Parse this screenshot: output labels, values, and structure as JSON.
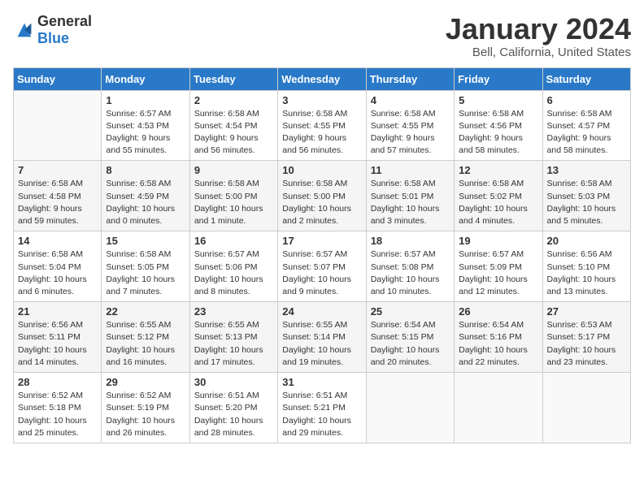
{
  "logo": {
    "text_general": "General",
    "text_blue": "Blue"
  },
  "title": "January 2024",
  "subtitle": "Bell, California, United States",
  "days_of_week": [
    "Sunday",
    "Monday",
    "Tuesday",
    "Wednesday",
    "Thursday",
    "Friday",
    "Saturday"
  ],
  "weeks": [
    [
      {
        "day": "",
        "info": ""
      },
      {
        "day": "1",
        "info": "Sunrise: 6:57 AM\nSunset: 4:53 PM\nDaylight: 9 hours\nand 55 minutes."
      },
      {
        "day": "2",
        "info": "Sunrise: 6:58 AM\nSunset: 4:54 PM\nDaylight: 9 hours\nand 56 minutes."
      },
      {
        "day": "3",
        "info": "Sunrise: 6:58 AM\nSunset: 4:55 PM\nDaylight: 9 hours\nand 56 minutes."
      },
      {
        "day": "4",
        "info": "Sunrise: 6:58 AM\nSunset: 4:55 PM\nDaylight: 9 hours\nand 57 minutes."
      },
      {
        "day": "5",
        "info": "Sunrise: 6:58 AM\nSunset: 4:56 PM\nDaylight: 9 hours\nand 58 minutes."
      },
      {
        "day": "6",
        "info": "Sunrise: 6:58 AM\nSunset: 4:57 PM\nDaylight: 9 hours\nand 58 minutes."
      }
    ],
    [
      {
        "day": "7",
        "info": "Sunrise: 6:58 AM\nSunset: 4:58 PM\nDaylight: 9 hours\nand 59 minutes."
      },
      {
        "day": "8",
        "info": "Sunrise: 6:58 AM\nSunset: 4:59 PM\nDaylight: 10 hours\nand 0 minutes."
      },
      {
        "day": "9",
        "info": "Sunrise: 6:58 AM\nSunset: 5:00 PM\nDaylight: 10 hours\nand 1 minute."
      },
      {
        "day": "10",
        "info": "Sunrise: 6:58 AM\nSunset: 5:00 PM\nDaylight: 10 hours\nand 2 minutes."
      },
      {
        "day": "11",
        "info": "Sunrise: 6:58 AM\nSunset: 5:01 PM\nDaylight: 10 hours\nand 3 minutes."
      },
      {
        "day": "12",
        "info": "Sunrise: 6:58 AM\nSunset: 5:02 PM\nDaylight: 10 hours\nand 4 minutes."
      },
      {
        "day": "13",
        "info": "Sunrise: 6:58 AM\nSunset: 5:03 PM\nDaylight: 10 hours\nand 5 minutes."
      }
    ],
    [
      {
        "day": "14",
        "info": "Sunrise: 6:58 AM\nSunset: 5:04 PM\nDaylight: 10 hours\nand 6 minutes."
      },
      {
        "day": "15",
        "info": "Sunrise: 6:58 AM\nSunset: 5:05 PM\nDaylight: 10 hours\nand 7 minutes."
      },
      {
        "day": "16",
        "info": "Sunrise: 6:57 AM\nSunset: 5:06 PM\nDaylight: 10 hours\nand 8 minutes."
      },
      {
        "day": "17",
        "info": "Sunrise: 6:57 AM\nSunset: 5:07 PM\nDaylight: 10 hours\nand 9 minutes."
      },
      {
        "day": "18",
        "info": "Sunrise: 6:57 AM\nSunset: 5:08 PM\nDaylight: 10 hours\nand 10 minutes."
      },
      {
        "day": "19",
        "info": "Sunrise: 6:57 AM\nSunset: 5:09 PM\nDaylight: 10 hours\nand 12 minutes."
      },
      {
        "day": "20",
        "info": "Sunrise: 6:56 AM\nSunset: 5:10 PM\nDaylight: 10 hours\nand 13 minutes."
      }
    ],
    [
      {
        "day": "21",
        "info": "Sunrise: 6:56 AM\nSunset: 5:11 PM\nDaylight: 10 hours\nand 14 minutes."
      },
      {
        "day": "22",
        "info": "Sunrise: 6:55 AM\nSunset: 5:12 PM\nDaylight: 10 hours\nand 16 minutes."
      },
      {
        "day": "23",
        "info": "Sunrise: 6:55 AM\nSunset: 5:13 PM\nDaylight: 10 hours\nand 17 minutes."
      },
      {
        "day": "24",
        "info": "Sunrise: 6:55 AM\nSunset: 5:14 PM\nDaylight: 10 hours\nand 19 minutes."
      },
      {
        "day": "25",
        "info": "Sunrise: 6:54 AM\nSunset: 5:15 PM\nDaylight: 10 hours\nand 20 minutes."
      },
      {
        "day": "26",
        "info": "Sunrise: 6:54 AM\nSunset: 5:16 PM\nDaylight: 10 hours\nand 22 minutes."
      },
      {
        "day": "27",
        "info": "Sunrise: 6:53 AM\nSunset: 5:17 PM\nDaylight: 10 hours\nand 23 minutes."
      }
    ],
    [
      {
        "day": "28",
        "info": "Sunrise: 6:52 AM\nSunset: 5:18 PM\nDaylight: 10 hours\nand 25 minutes."
      },
      {
        "day": "29",
        "info": "Sunrise: 6:52 AM\nSunset: 5:19 PM\nDaylight: 10 hours\nand 26 minutes."
      },
      {
        "day": "30",
        "info": "Sunrise: 6:51 AM\nSunset: 5:20 PM\nDaylight: 10 hours\nand 28 minutes."
      },
      {
        "day": "31",
        "info": "Sunrise: 6:51 AM\nSunset: 5:21 PM\nDaylight: 10 hours\nand 29 minutes."
      },
      {
        "day": "",
        "info": ""
      },
      {
        "day": "",
        "info": ""
      },
      {
        "day": "",
        "info": ""
      }
    ]
  ]
}
